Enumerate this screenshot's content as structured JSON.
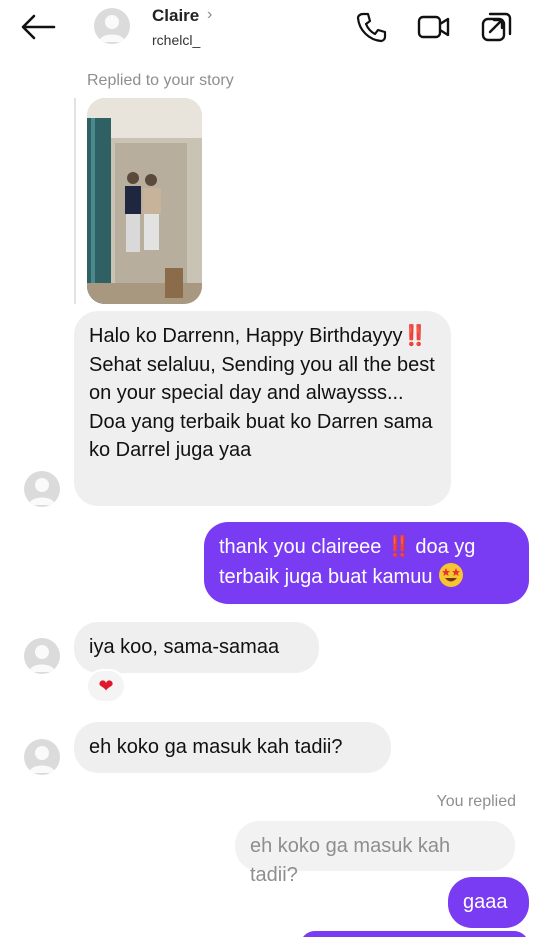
{
  "header": {
    "name": "Claire",
    "username": "rchelcl_",
    "chevron": "›",
    "icons": [
      "back-arrow-icon",
      "phone-icon",
      "video-camera-icon",
      "open-external-icon"
    ]
  },
  "story": {
    "replied_label": "Replied to your story"
  },
  "messages": [
    {
      "from": "them",
      "text": "Halo ko Darrenn, Happy Birthdayyy",
      "emph": "‼️",
      "text2": "Sehat selaluu, Sending you all the best on your special day and alwaysss... Doa yang terbaik buat ko Darren sama ko Darrel juga yaa"
    },
    {
      "from": "me",
      "text": "thank you claireee ",
      "emph": "‼️",
      "text2": " doa yg terbaik juga buat kamuu ",
      "emoji": "star-struck-emoji"
    },
    {
      "from": "them",
      "text": "iya koo, sama-samaa",
      "reaction": "❤"
    },
    {
      "from": "them",
      "text": "eh koko ga masuk kah tadii?"
    },
    {
      "from": "me",
      "reply_label": "You replied",
      "quoted": "eh koko ga masuk kah tadii?",
      "text": "gaaa"
    }
  ],
  "colors": {
    "outgoing_bubble": "#7a3cf2",
    "incoming_bubble": "#efefef",
    "muted_text": "#8e8e8e",
    "reaction_heart": "#e0162b"
  }
}
